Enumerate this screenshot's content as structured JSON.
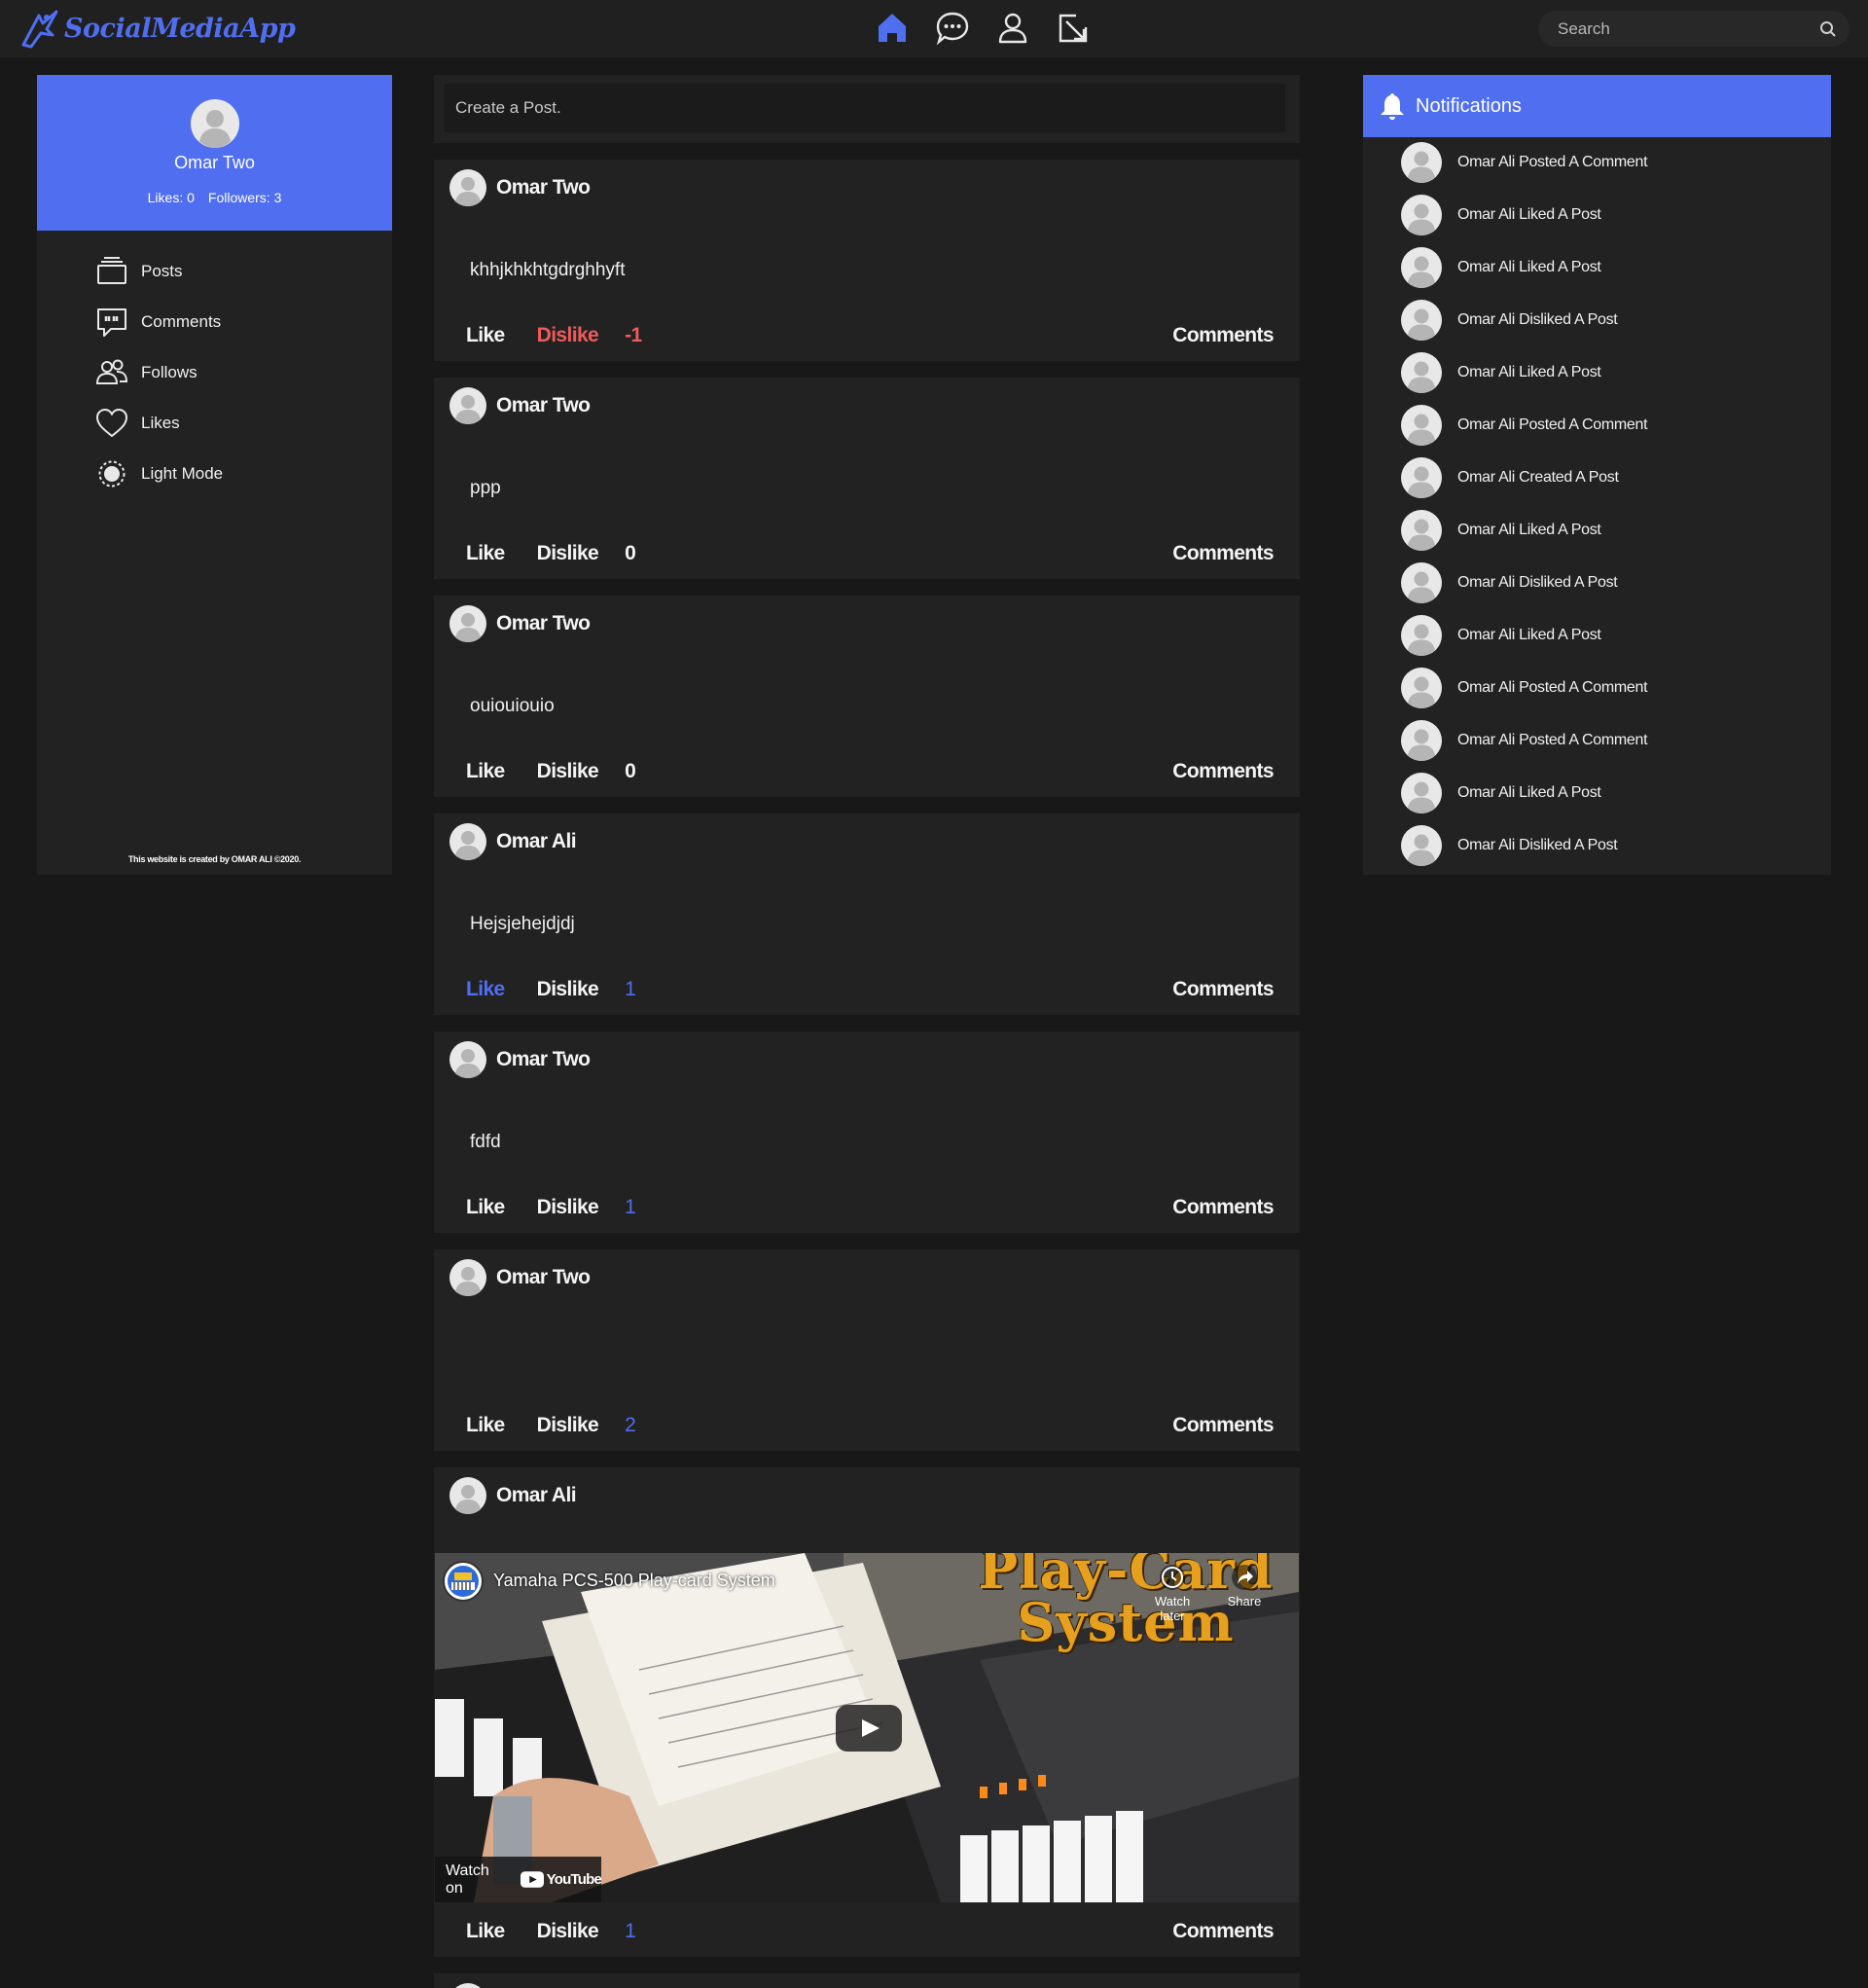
{
  "header": {
    "brand": "SocialMediaApp",
    "nav": [
      "home-icon",
      "chat-icon",
      "profile-icon",
      "logout-icon"
    ],
    "search_placeholder": "Search",
    "accent": "#4f6ef0"
  },
  "profile": {
    "name": "Omar Two",
    "likes": "Likes: 0",
    "followers": "Followers: 3"
  },
  "menu": {
    "items": [
      {
        "label": "Posts",
        "icon": "posts-icon"
      },
      {
        "label": "Comments",
        "icon": "comments-icon"
      },
      {
        "label": "Follows",
        "icon": "follows-icon"
      },
      {
        "label": "Likes",
        "icon": "heart-icon"
      },
      {
        "label": "Light Mode",
        "icon": "sun-icon"
      }
    ]
  },
  "footer": "This website is created by OMAR ALI ©2020.",
  "create_post": {
    "placeholder": "Create a Post."
  },
  "actions": {
    "like": "Like",
    "dislike": "Dislike",
    "comments": "Comments"
  },
  "posts": [
    {
      "author": "Omar Two",
      "text": "khhjkhkhtgdrghhyft",
      "score": "-1",
      "state": "disliked"
    },
    {
      "author": "Omar Two",
      "text": "ppp",
      "score": "0",
      "state": "none"
    },
    {
      "author": "Omar Two",
      "text": "ouiouiouio",
      "score": "0",
      "state": "none"
    },
    {
      "author": "Omar Ali",
      "text": "Hejsjehejdjdj",
      "score": "1",
      "state": "liked"
    },
    {
      "author": "Omar Two",
      "text": "fdfd",
      "score": "1",
      "state": "none"
    },
    {
      "author": "Omar Two",
      "text": "",
      "score": "2",
      "state": "none"
    },
    {
      "author": "Omar Ali",
      "text": "",
      "score": "1",
      "state": "none",
      "video": {
        "title": "Yamaha PCS-500 Play-card System",
        "overlay_title": "Play-Card System",
        "watch_later": "Watch later",
        "share": "Share",
        "watch_on": "Watch on",
        "platform": "YouTube"
      }
    }
  ],
  "notifications": {
    "title": "Notifications",
    "items": [
      "Omar Ali Posted A Comment",
      "Omar Ali Liked A Post",
      "Omar Ali Liked A Post",
      "Omar Ali Disliked A Post",
      "Omar Ali Liked A Post",
      "Omar Ali Posted A Comment",
      "Omar Ali Created A Post",
      "Omar Ali Liked A Post",
      "Omar Ali Disliked A Post",
      "Omar Ali Liked A Post",
      "Omar Ali Posted A Comment",
      "Omar Ali Posted A Comment",
      "Omar Ali Liked A Post",
      "Omar Ali Disliked A Post"
    ]
  }
}
